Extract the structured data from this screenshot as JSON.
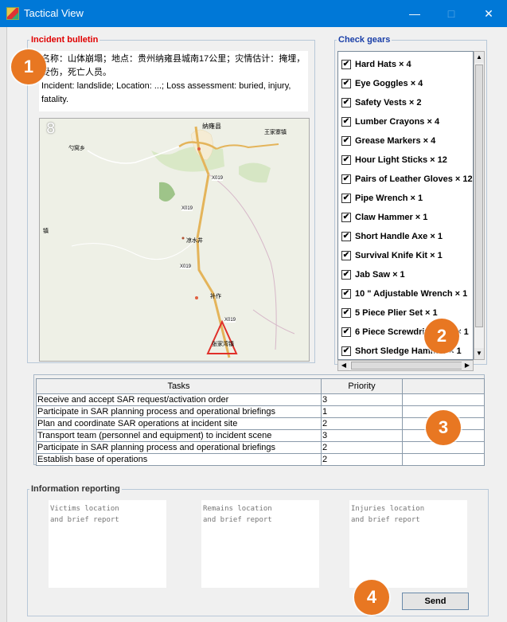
{
  "window": {
    "title": "Tactical View",
    "minimize_glyph": "—",
    "maximize_glyph": "□",
    "close_glyph": "✕"
  },
  "bulletin": {
    "legend": "Incident bulletin",
    "text_cn_line1": "名称：山体崩塌；地点：贵州纳雍县城南17公里；灾情估计：掩埋，",
    "text_cn_line2": "受伤，死亡人员。",
    "text_en_line1": "Incident: landslide; Location: ...; Loss assessment: buried, injury,",
    "text_en_line2": "fatality.",
    "map": {
      "zoom_glyph": "8",
      "labels": [
        "纳雍县",
        "王家寨镇",
        "勺窝乡",
        "X019",
        "X019",
        "X019",
        "X019",
        "凉水井",
        "补作",
        "张家湾镇",
        "镇"
      ]
    }
  },
  "gears": {
    "legend": "Check gears",
    "items": [
      {
        "label": "Hard Hats × 4",
        "checked": true
      },
      {
        "label": "Eye Goggles × 4",
        "checked": true
      },
      {
        "label": "Safety Vests × 2",
        "checked": true
      },
      {
        "label": "Lumber Crayons × 4",
        "checked": true
      },
      {
        "label": "Grease Markers × 4",
        "checked": true
      },
      {
        "label": "Hour Light Sticks × 12",
        "checked": true
      },
      {
        "label": "Pairs of Leather Gloves × 12",
        "checked": true
      },
      {
        "label": "Pipe Wrench × 1",
        "checked": true
      },
      {
        "label": "Claw Hammer × 1",
        "checked": true
      },
      {
        "label": "Short Handle Axe × 1",
        "checked": true
      },
      {
        "label": "Survival Knife Kit × 1",
        "checked": true
      },
      {
        "label": "Jab Saw × 1",
        "checked": true
      },
      {
        "label": "10 \" Adjustable Wrench × 1",
        "checked": true
      },
      {
        "label": "5 Piece Plier Set × 1",
        "checked": true
      },
      {
        "label": "6 Piece Screwdriver Set × 1",
        "checked": true
      },
      {
        "label": "Short Sledge Hammer × 1",
        "checked": true
      }
    ]
  },
  "tasks": {
    "headers": [
      "Tasks",
      "Priority",
      ""
    ],
    "rows": [
      {
        "task": "Receive and accept SAR request/activation order",
        "priority": "3"
      },
      {
        "task": "Participate in SAR planning process and operational briefings",
        "priority": "1"
      },
      {
        "task": "Plan and coordinate SAR operations at incident site",
        "priority": "2"
      },
      {
        "task": "Transport team (personnel and equipment) to incident scene",
        "priority": "3"
      },
      {
        "task": "Participate in SAR planning process and operational briefings",
        "priority": "2"
      },
      {
        "task": "Establish base of operations",
        "priority": "2"
      }
    ]
  },
  "reporting": {
    "legend": "Information reporting",
    "victims_placeholder": "Victims location\nand brief report",
    "remains_placeholder": "Remains location\nand brief report",
    "injuries_placeholder": "Injuries location\nand brief report",
    "send_label": "Send"
  },
  "badges": [
    "1",
    "2",
    "3",
    "4"
  ],
  "colors": {
    "titlebar": "#0078d7",
    "bulletin_legend": "#e00000",
    "gears_legend": "#1a3fa8",
    "badge": "#e87722"
  }
}
